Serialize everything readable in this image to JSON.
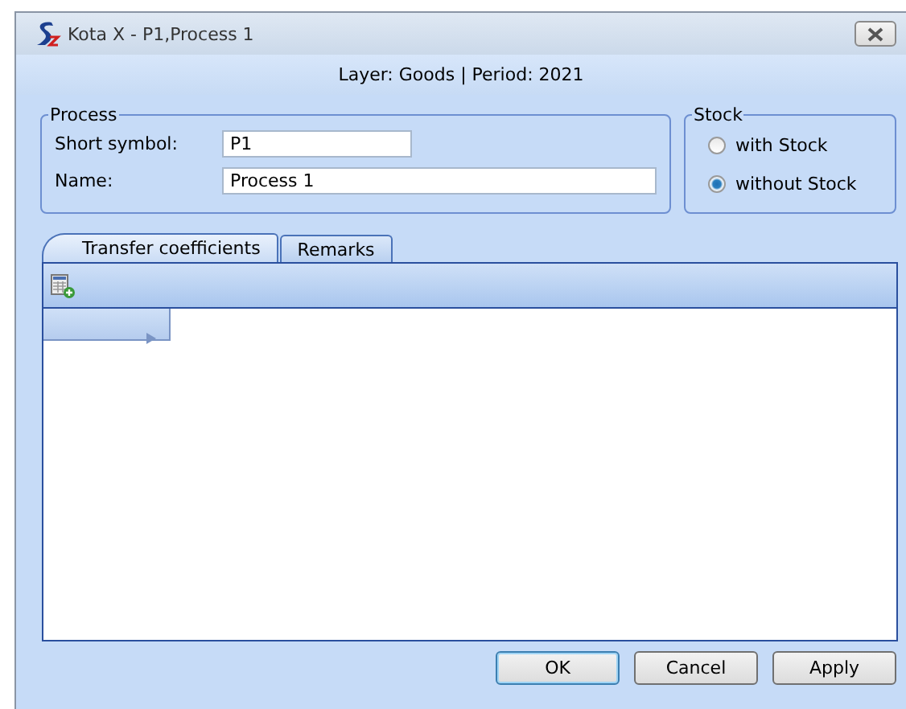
{
  "window": {
    "title": "Kota X - P1,Process 1"
  },
  "subtitle": "Layer: Goods | Period: 2021",
  "process": {
    "title": "Process",
    "fields": [
      {
        "label": "Short symbol:",
        "value": "P1",
        "kind": "short"
      },
      {
        "label": "Name:",
        "value": "Process 1",
        "kind": "long"
      }
    ]
  },
  "stock": {
    "title": "Stock",
    "options": [
      {
        "label": "with Stock",
        "selected": false
      },
      {
        "label": "without Stock",
        "selected": true
      }
    ]
  },
  "tabs": [
    {
      "label": "Transfer coefficients",
      "selected": true
    },
    {
      "label": "Remarks",
      "selected": false
    }
  ],
  "buttons": [
    {
      "label": "OK",
      "kind": "default"
    },
    {
      "label": "Cancel",
      "kind": "normal"
    },
    {
      "label": "Apply",
      "kind": "normal"
    }
  ]
}
